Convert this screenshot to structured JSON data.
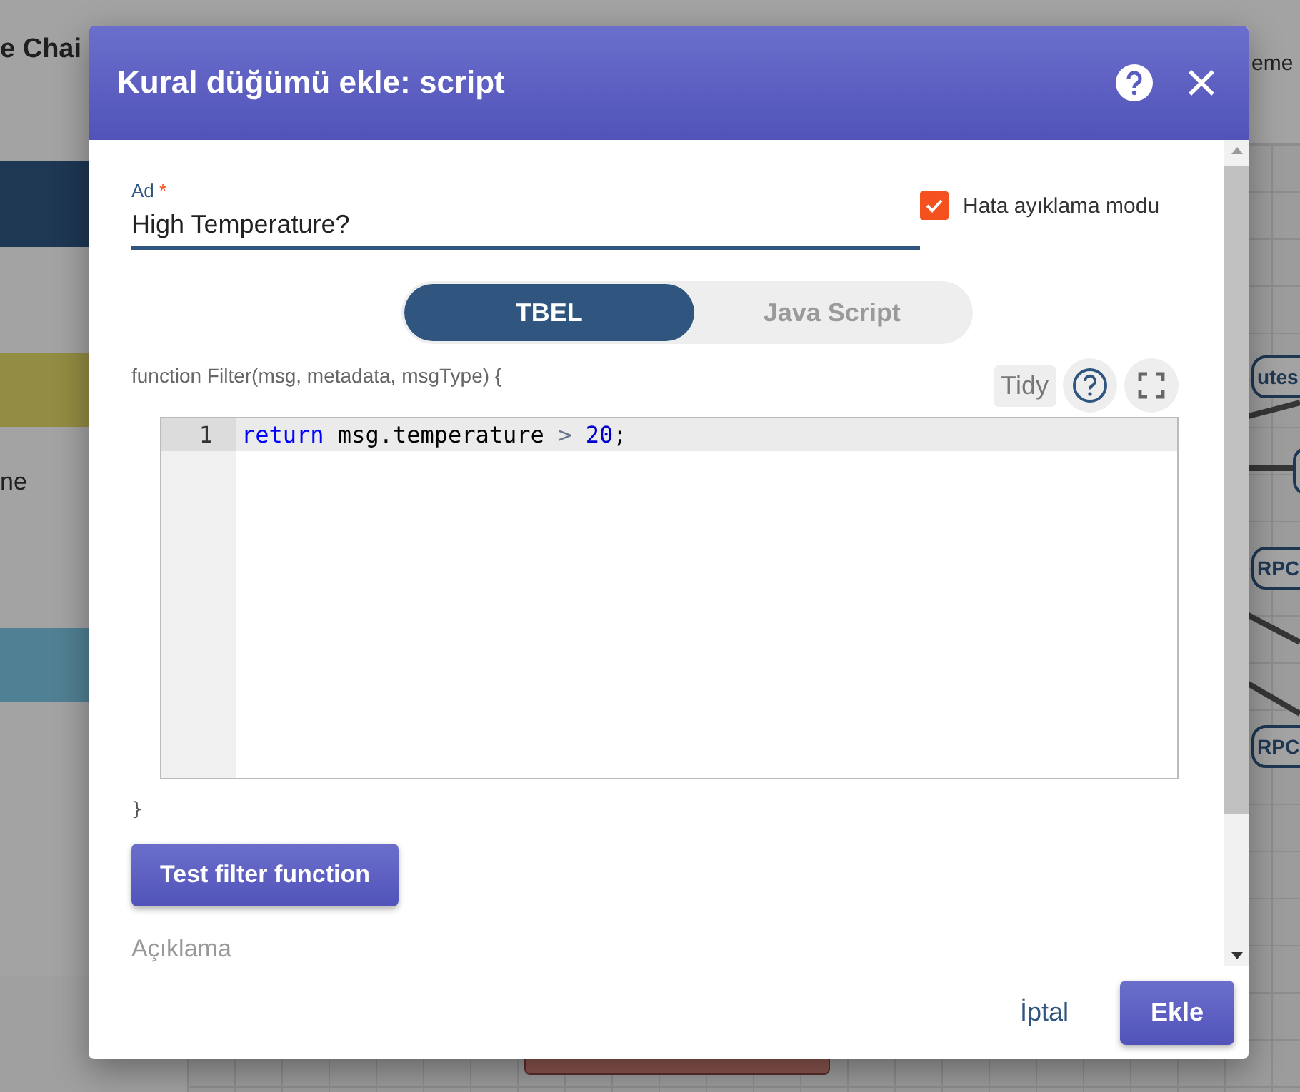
{
  "background": {
    "page_title": "e Chai",
    "header_text": "eme",
    "sidebar_text": "ne",
    "nodes": [
      {
        "label": "utes"
      },
      {
        "label": "RPC"
      },
      {
        "label": "RPC"
      }
    ]
  },
  "dialog": {
    "title": "Kural düğümü ekle: script",
    "name_field": {
      "label": "Ad",
      "required_mark": "*",
      "value": "High Temperature?"
    },
    "debug_mode": {
      "label": "Hata ayıklama modu",
      "checked": true
    },
    "language_tabs": [
      {
        "label": "TBEL",
        "selected": true
      },
      {
        "label": "Java Script",
        "selected": false
      }
    ],
    "function_header": "function Filter(msg, metadata, msgType) {",
    "tidy_button": "Tidy",
    "code_lines": [
      {
        "number": "1",
        "tokens": [
          {
            "text": "return",
            "kind": "keyword"
          },
          {
            "text": " msg.temperature ",
            "kind": "plain"
          },
          {
            "text": ">",
            "kind": "operator"
          },
          {
            "text": " 20",
            "kind": "number"
          },
          {
            "text": ";",
            "kind": "plain"
          }
        ]
      }
    ],
    "function_footer": "}",
    "test_button": "Test filter function",
    "description_label": "Açıklama",
    "buttons": [
      {
        "label": "İptal",
        "kind": "text"
      },
      {
        "label": "Ekle",
        "kind": "primary"
      }
    ]
  }
}
